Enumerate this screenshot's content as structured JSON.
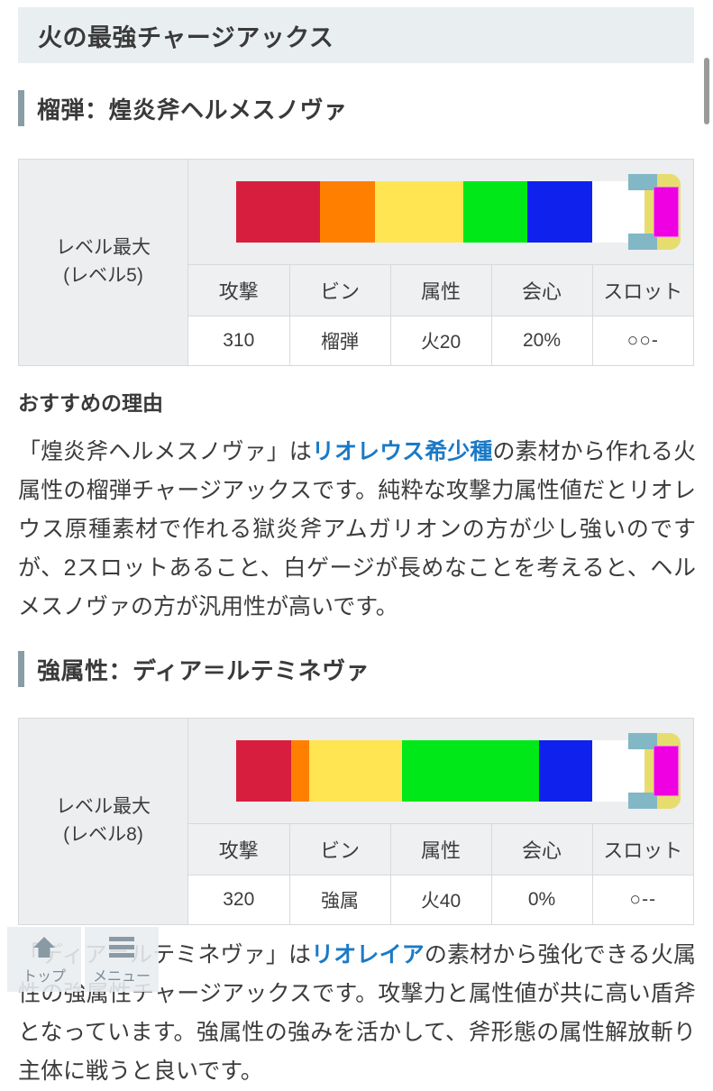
{
  "header": {
    "title": "火の最強チャージアックス"
  },
  "scrollbar": {
    "present": true
  },
  "sections": [
    {
      "heading": "榴弾：煌炎斧ヘルメスノヴァ",
      "card": {
        "level_label_line1": "レベル最大",
        "level_label_line2": "(レベル5)",
        "sharpness": {
          "segments": [
            {
              "name": "red",
              "color": "#d81e3f",
              "width_pct": 20.5
            },
            {
              "name": "orange",
              "color": "#ff8000",
              "width_pct": 13.5
            },
            {
              "name": "yellow",
              "color": "#ffe552",
              "width_pct": 21.5
            },
            {
              "name": "green",
              "color": "#00e817",
              "width_pct": 15.5
            },
            {
              "name": "blue",
              "color": "#0f22ed",
              "width_pct": 16.0
            },
            {
              "name": "white",
              "color": "#ffffff",
              "width_pct": 13.0
            }
          ],
          "extension": {
            "bracket_color": "#82b7c6",
            "frame_color": "#e7dd6f",
            "purple_color": "#ef00e3"
          }
        },
        "columns": [
          "攻撃",
          "ビン",
          "属性",
          "会心",
          "スロット"
        ],
        "values": [
          "310",
          "榴弾",
          "火20",
          "20%",
          "○○-"
        ]
      },
      "sub_heading": "おすすめの理由",
      "paragraph": {
        "before": "「煌炎斧ヘルメスノヴァ」は",
        "link": "リオレウス希少種",
        "after": "の素材から作れる火属性の榴弾チャージアックスです。純粋な攻撃力属性値だとリオレウス原種素材で作れる獄炎斧アムガリオンの方が少し強いのですが、2スロットあること、白ゲージが長めなことを考えると、ヘルメスノヴァの方が汎用性が高いです。"
      }
    },
    {
      "heading": "強属性：ディア＝ルテミネヴァ",
      "card": {
        "level_label_line1": "レベル最大",
        "level_label_line2": "(レベル8)",
        "sharpness": {
          "segments": [
            {
              "name": "red",
              "color": "#d81e3f",
              "width_pct": 13.5
            },
            {
              "name": "orange",
              "color": "#ff8000",
              "width_pct": 4.5
            },
            {
              "name": "yellow",
              "color": "#ffe552",
              "width_pct": 22.5
            },
            {
              "name": "green",
              "color": "#00e817",
              "width_pct": 33.5
            },
            {
              "name": "blue",
              "color": "#0f22ed",
              "width_pct": 13.0
            },
            {
              "name": "white",
              "color": "#ffffff",
              "width_pct": 13.0
            }
          ],
          "extension": {
            "bracket_color": "#82b7c6",
            "frame_color": "#e7dd6f",
            "purple_color": "#ef00e3"
          }
        },
        "columns": [
          "攻撃",
          "ビン",
          "属性",
          "会心",
          "スロット"
        ],
        "values": [
          "320",
          "強属",
          "火40",
          "0%",
          "○--"
        ]
      },
      "sub_heading": "",
      "paragraph": {
        "before": "「ディア＝ルテミネヴァ」は",
        "link": "リオレイア",
        "after": "の素材から強化できる火属性の強属性チャージアックスです。攻撃力と属性値が共に高い盾斧となっています。強属性の強みを活かして、斧形態の属性解放斬り主体に戦うと良いです。"
      }
    }
  ],
  "floating_buttons": [
    {
      "icon": "arrow-up-icon",
      "label": "トップ"
    },
    {
      "icon": "hamburger-menu-icon",
      "label": "メニュー"
    }
  ],
  "colors": {
    "header_bg": "#e9eef1",
    "accent_bar": "#8a9ca6",
    "link": "#1a7ac7",
    "table_header_bg": "#eef0f1",
    "table_left_bg": "#eceeef",
    "border": "#d7dadc"
  }
}
